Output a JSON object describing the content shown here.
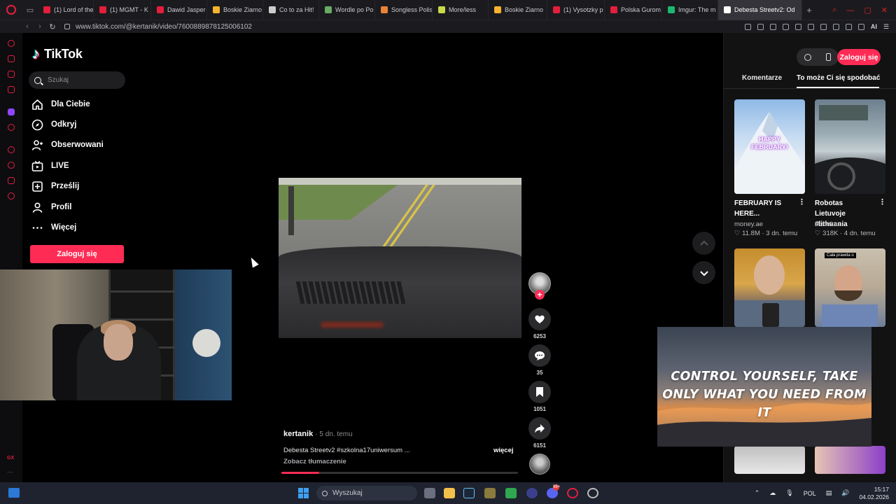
{
  "browser": {
    "tabs": [
      {
        "label": "(1) Lord of the",
        "color": "#e51e3c"
      },
      {
        "label": "(1) MGMT - K",
        "color": "#e51e3c"
      },
      {
        "label": "Dawid Jasper",
        "color": "#e51e3c"
      },
      {
        "label": "Boskie Ziarno",
        "color": "#f7b32b"
      },
      {
        "label": "Co to za Hit!",
        "color": "#cccccc"
      },
      {
        "label": "Wordle po Po",
        "color": "#6aaa64"
      },
      {
        "label": "Songless Polis",
        "color": "#e8833a"
      },
      {
        "label": "More/less",
        "color": "#c9d94a"
      },
      {
        "label": "Boskie Ziarno",
        "color": "#f7b32b"
      },
      {
        "label": "(1) Vysotzky p",
        "color": "#e51e3c"
      },
      {
        "label": "Polska Gurom",
        "color": "#e51e3c"
      },
      {
        "label": "Imgur: The m",
        "color": "#1bb76e"
      },
      {
        "label": "Debesta Streetv2: Od",
        "color": "#ffffff",
        "active": true
      }
    ],
    "url": "www.tiktok.com/@kertanik/video/7600889878125006102"
  },
  "tiktok": {
    "logo": "TikTok",
    "search_placeholder": "Szukaj",
    "nav": [
      {
        "label": "Dla Ciebie",
        "icon": "home-icon"
      },
      {
        "label": "Odkryj",
        "icon": "compass-icon"
      },
      {
        "label": "Obserwowani",
        "icon": "following-icon"
      },
      {
        "label": "LIVE",
        "icon": "live-tv-icon"
      },
      {
        "label": "Prześlij",
        "icon": "upload-icon"
      },
      {
        "label": "Profil",
        "icon": "profile-icon"
      },
      {
        "label": "Więcej",
        "icon": "more-dots-icon"
      }
    ],
    "login_label": "Zaloguj się",
    "video": {
      "author": "kertanik",
      "posted": "· 5 dn. temu",
      "description": "Debesta Streetv2 #szkolna17uniwersum ...",
      "more": "więcej",
      "translate": "Zobacz tłumaczenie",
      "progress_pct": 16
    },
    "actions": {
      "likes": "6253",
      "comments": "35",
      "saves": "1051",
      "shares": "6151"
    },
    "right_panel": {
      "login_label": "Zaloguj się",
      "tab_comments": "Komentarze",
      "tab_recommended": "To może Ci się spodobać",
      "items": [
        {
          "title": "FEBRUARY IS HERE...",
          "author": "money.ae",
          "stats": "11.8M · 3 dn. temu",
          "overlay": "HAPPY FEBRUARY!"
        },
        {
          "title": "Robotas Lietuvoje #lithuania",
          "author": "tikstokas",
          "stats": "318K · 4 dn. temu",
          "overlay": ""
        },
        {
          "title": "",
          "author": "",
          "stats": "",
          "overlay": ""
        },
        {
          "title": "",
          "author": "",
          "stats": "",
          "overlay": "Cała prawda o"
        }
      ]
    }
  },
  "overlay_quote": "CONTROL YOURSELF, TAKE ONLY WHAT YOU NEED FROM IT",
  "taskbar": {
    "search_placeholder": "Wyszukaj",
    "lang": "POL",
    "time": "15:17",
    "date": "04.02.2026",
    "badge": "99+"
  },
  "colors": {
    "accent": "#fe2c55",
    "opera_red": "#e51e3c",
    "tiktok_cyan": "#25f4ee"
  }
}
